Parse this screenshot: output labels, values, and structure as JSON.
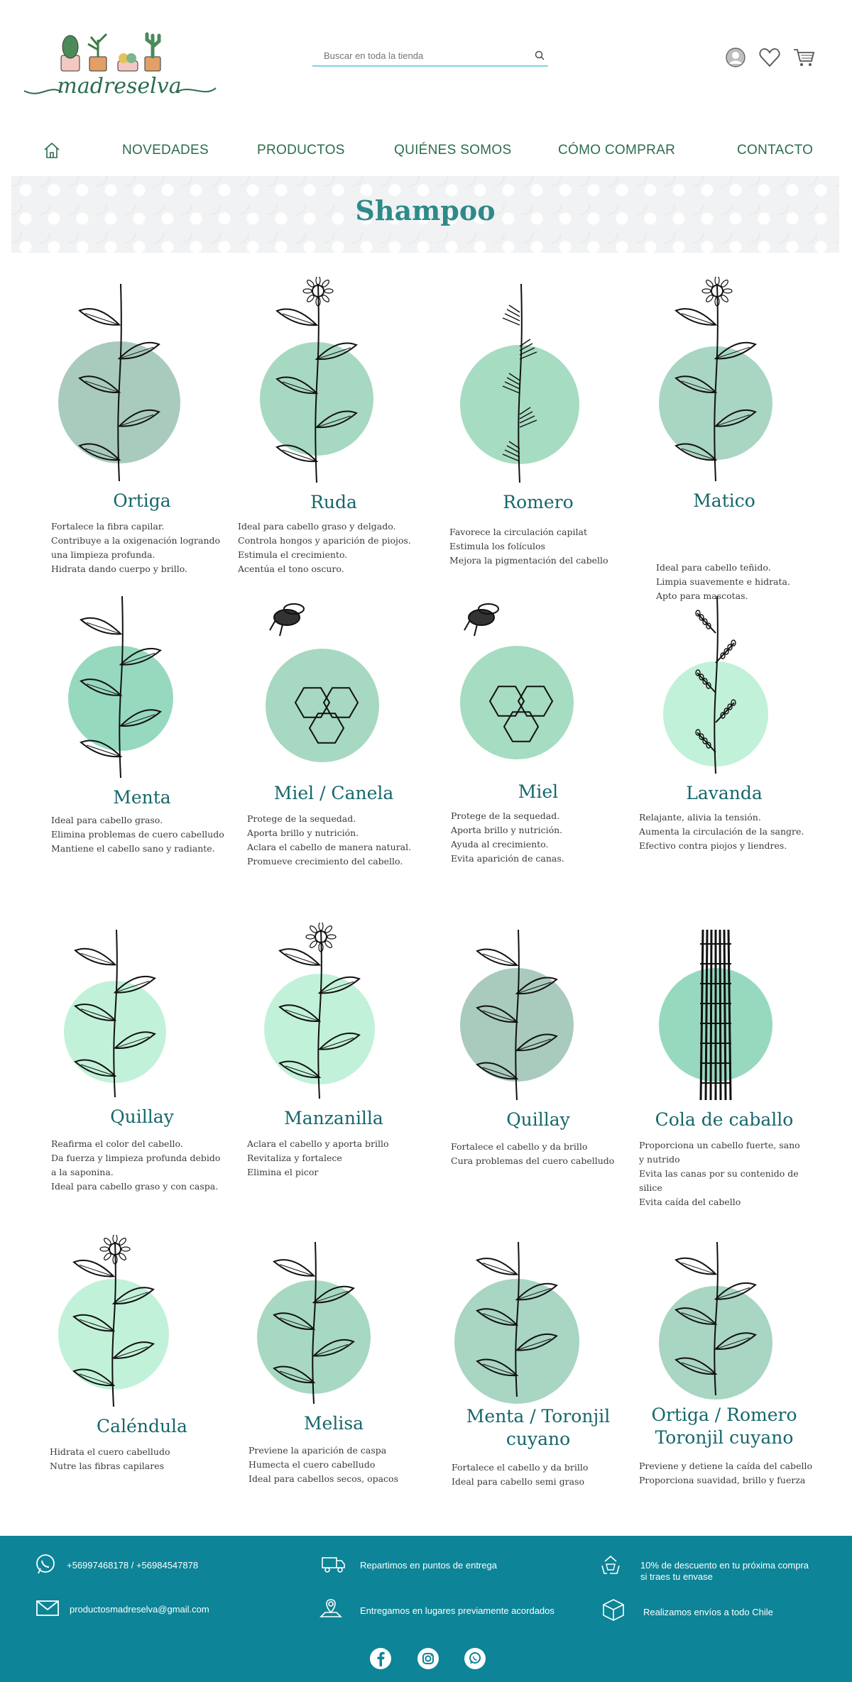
{
  "header": {
    "logo_text": "madreselva",
    "search_placeholder": "Buscar en toda la tienda"
  },
  "icons": {
    "search": "search-icon",
    "user": "user-icon",
    "wishlist": "heart-icon",
    "cart": "cart-icon",
    "home": "home-icon"
  },
  "nav": {
    "items": [
      "NOVEDADES",
      "PRODUCTOS",
      "QUIÉNES SOMOS",
      "CÓMO COMPRAR",
      "CONTACTO"
    ]
  },
  "banner": {
    "title": "Shampoo"
  },
  "colors": {
    "accent": "#2e8a8a",
    "nav": "#2b6d4e",
    "footer": "#0d8497"
  },
  "products": [
    {
      "name": "Ortiga",
      "lines": [
        "Fortalece la fibra capilar.",
        "Contribuye a la oxigenación logrando\nuna limpieza profunda.",
        "Hidrata dando cuerpo y brillo."
      ]
    },
    {
      "name": "Ruda",
      "lines": [
        "Ideal para cabello graso y delgado.",
        "Controla hongos y aparición de piojos.",
        "Estimula el crecimiento.",
        "Acentúa el tono oscuro."
      ]
    },
    {
      "name": "Romero",
      "lines": [
        "Favorece la circulación capilat\nEstimula los folículos",
        "Mejora la pigmentación del cabello"
      ]
    },
    {
      "name": "Matico",
      "lines": [
        "Ideal para cabello teñido.",
        "Limpia suavemente e hidrata.",
        "Apto para mascotas."
      ]
    },
    {
      "name": "Menta",
      "lines": [
        "Ideal para cabello graso.",
        "Elimina problemas de cuero cabelludo",
        "Mantiene el cabello sano y radiante."
      ]
    },
    {
      "name": "Miel / Canela",
      "lines": [
        "Protege de la sequedad.",
        "Aporta brillo y nutrición.",
        "Aclara el cabello de manera natural.",
        "Promueve crecimiento del cabello."
      ]
    },
    {
      "name": "Miel",
      "lines": [
        "Protege de la sequedad.",
        "Aporta brillo y nutrición.",
        "Ayuda al crecimiento.",
        "Evita aparición de canas."
      ]
    },
    {
      "name": "Lavanda",
      "lines": [
        "Relajante, alivia la tensión.",
        "Aumenta la circulación de la sangre.",
        "Efectivo contra  piojos y liendres."
      ]
    },
    {
      "name": "Quillay",
      "lines": [
        "Reafirma el color del cabello.\nDa fuerza y limpieza profunda debido\na la saponina.",
        "Ideal para cabello graso y con caspa."
      ]
    },
    {
      "name": "Manzanilla",
      "lines": [
        "Aclara el cabello y aporta brillo",
        "Revitaliza y fortalece",
        "Elimina el picor"
      ]
    },
    {
      "name": "Quillay",
      "lines": [
        "Fortalece el cabello y da brillo",
        "Cura problemas del cuero cabelludo"
      ]
    },
    {
      "name": "Cola de caballo",
      "lines": [
        "Proporciona un cabello fuerte, sano\ny nutrido",
        "Evita las canas por su contenido de silice",
        "Evita caída del cabello"
      ]
    },
    {
      "name": "Caléndula",
      "lines": [
        "Hidrata el cuero cabelludo",
        "Nutre las fibras capilares"
      ]
    },
    {
      "name": "Melisa",
      "lines": [
        "Previene la aparición de caspa",
        "Humecta el cuero cabelludo",
        "Ideal para cabellos secos, opacos"
      ]
    },
    {
      "name": "Menta / Toronjil\ncuyano",
      "lines": [
        "Fortalece el cabello y da brillo",
        "Ideal para cabello semi graso"
      ]
    },
    {
      "name": "Ortiga / Romero\nToronjil cuyano",
      "lines": [
        "Previene y detiene la caída del cabello",
        "Proporciona suavidad, brillo y fuerza"
      ]
    }
  ],
  "footer": {
    "phones": "+56997468178 / +56984547878",
    "email": "productosmadreselva@gmail.com",
    "delivery1": "Repartimos en puntos de entrega",
    "delivery2": "Entregamos en lugares previamente acordados",
    "discount": "10% de descuento en tu próxima compra\nsi traes tu envase",
    "shipping": "Realizamos envíos a todo Chile"
  }
}
